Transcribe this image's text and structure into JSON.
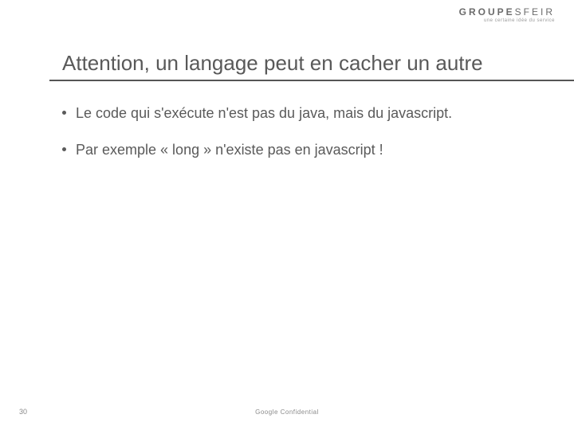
{
  "logo": {
    "main_a": "GROUPE",
    "main_b": "SFEIR",
    "sub": "une certaine idée du service"
  },
  "title": "Attention, un langage peut en cacher un autre",
  "bullets": [
    "Le code qui s'exécute n'est pas du java, mais du javascript.",
    "Par exemple « long » n'existe pas en javascript !"
  ],
  "page_number": "30",
  "footer": "Google Confidential"
}
